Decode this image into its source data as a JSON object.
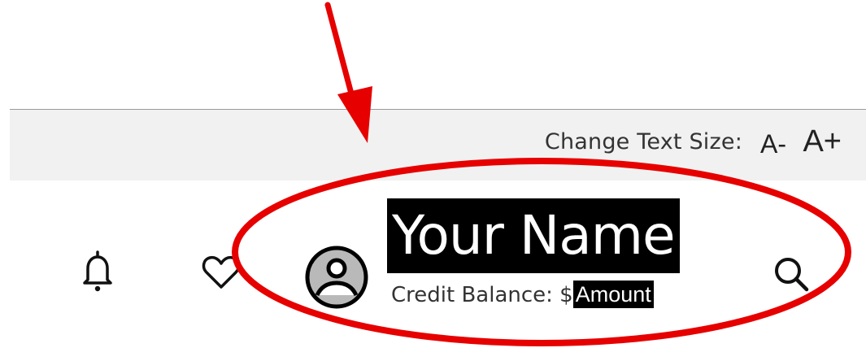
{
  "text_size_bar": {
    "label": "Change Text Size:",
    "decrease_label": "A-",
    "increase_label": "A+"
  },
  "header": {
    "user_name": "Your Name",
    "credit_label": "Credit Balance: $",
    "credit_amount": "Amount",
    "icons": {
      "notifications": "bell-icon",
      "favorites": "heart-icon",
      "profile": "avatar-icon",
      "search": "search-icon"
    }
  },
  "colors": {
    "annotation": "#e60000",
    "bar_background": "#f1f1f1",
    "name_highlight": "#000000"
  }
}
